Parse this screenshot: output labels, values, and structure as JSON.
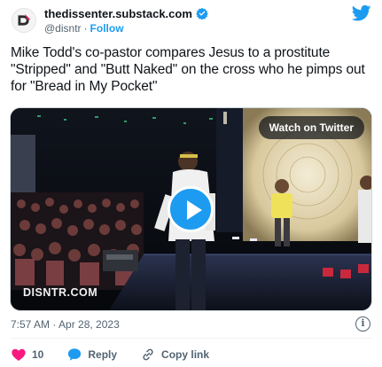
{
  "header": {
    "display_name": "thedissenter.substack.com",
    "handle": "@disntr",
    "separator": "·",
    "follow_label": "Follow"
  },
  "tweet": {
    "text": "Mike Todd's co-pastor compares Jesus to a prostitute \"Stripped\" and \"Butt Naked\" on the cross who he pimps out for \"Bread in My Pocket\""
  },
  "media": {
    "watch_label": "Watch on Twitter",
    "watermark": "DISNTR.COM"
  },
  "footer": {
    "timestamp": "7:57 AM · Apr 28, 2023",
    "info_glyph": "i",
    "actions": {
      "like_count": "10",
      "reply_label": "Reply",
      "copy_label": "Copy link"
    }
  },
  "colors": {
    "accent": "#1d9bf0",
    "like": "#f91880",
    "text": "#0f1419",
    "muted": "#536471"
  },
  "icons": [
    "disntr-logo-avatar",
    "verified-badge-icon",
    "twitter-bird-icon",
    "play-icon",
    "info-icon",
    "heart-icon",
    "reply-icon",
    "link-icon"
  ]
}
